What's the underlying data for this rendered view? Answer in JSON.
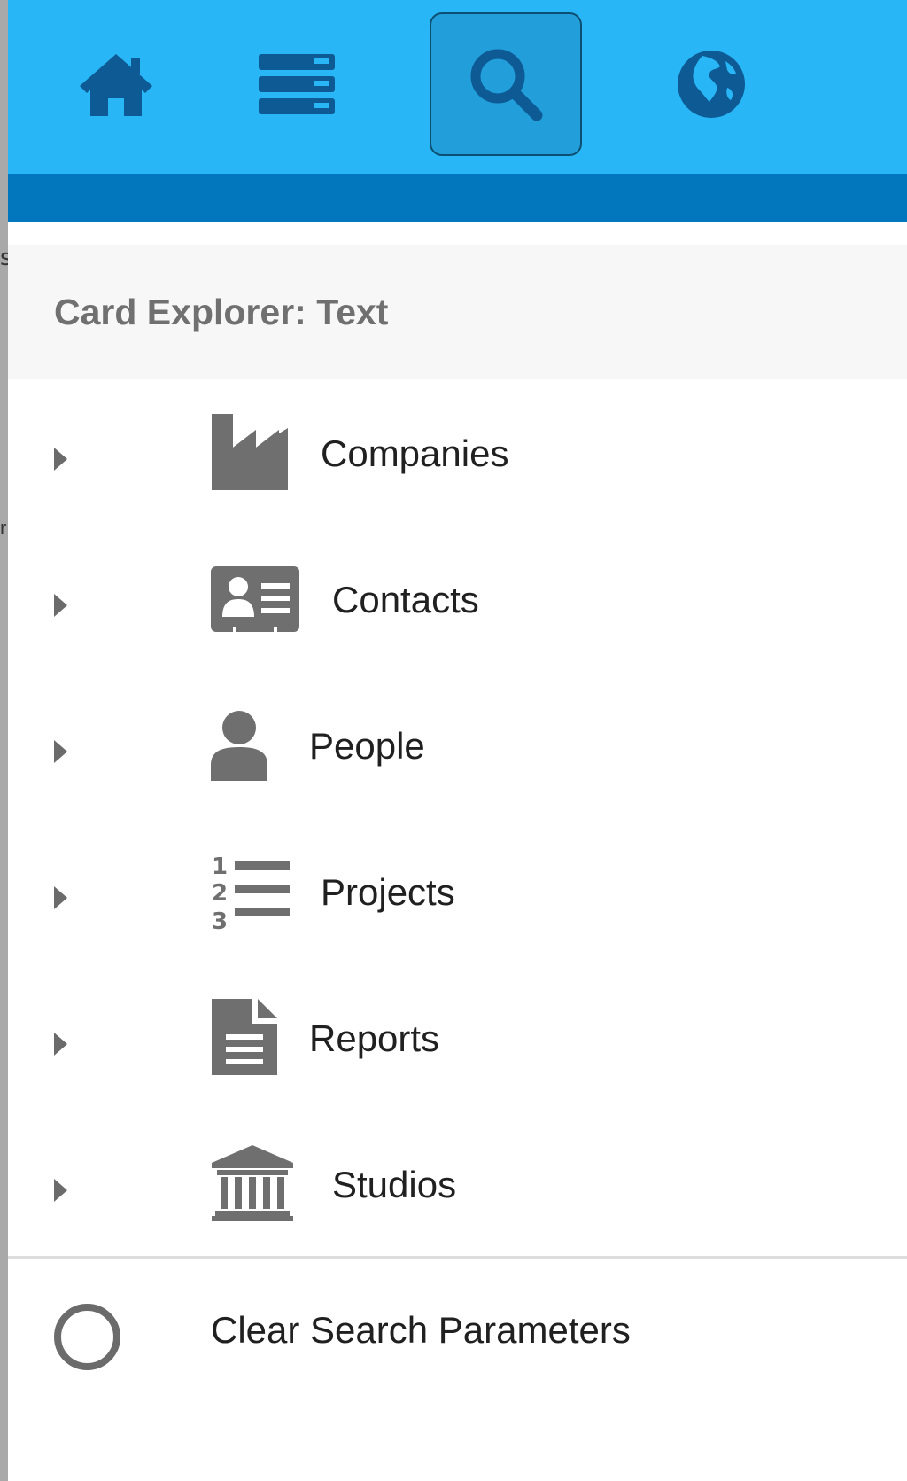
{
  "toolbar": {
    "buttons": [
      {
        "icon": "home-icon"
      },
      {
        "icon": "server-icon"
      },
      {
        "icon": "search-icon",
        "active": true
      },
      {
        "icon": "globe-icon"
      }
    ],
    "icon_color": "#0d5a94",
    "background": "#29b6f6",
    "strip_color": "#0277bd"
  },
  "explorer": {
    "title": "Card Explorer: Text"
  },
  "items": [
    {
      "label": "Companies",
      "icon": "factory-icon"
    },
    {
      "label": "Contacts",
      "icon": "contact-card-icon"
    },
    {
      "label": "People",
      "icon": "person-icon"
    },
    {
      "label": "Projects",
      "icon": "numbered-list-icon"
    },
    {
      "label": "Reports",
      "icon": "document-icon"
    },
    {
      "label": "Studios",
      "icon": "institution-icon"
    }
  ],
  "clear": {
    "label": "Clear Search Parameters",
    "icon": "radio-circle-icon"
  },
  "colors": {
    "item_icon": "#6f6f6f",
    "text": "#202020",
    "header_bg": "#f7f7f7"
  }
}
